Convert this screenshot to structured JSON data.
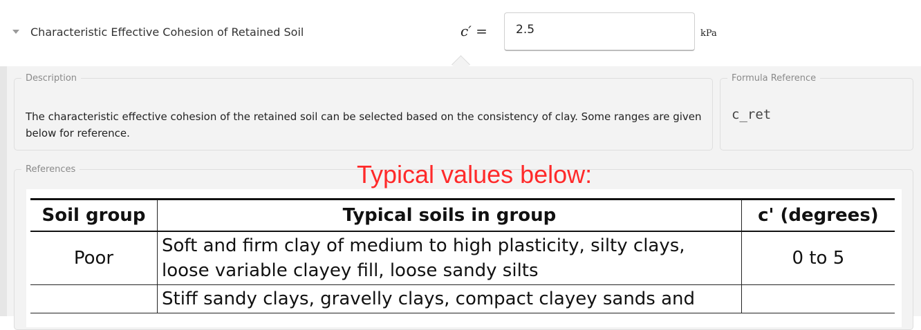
{
  "parameter": {
    "title": "Characteristic Effective Cohesion of Retained Soil",
    "symbol": "c′ =",
    "value": "2.5",
    "unit": "kPa"
  },
  "description": {
    "legend": "Description",
    "text": "The characteristic effective cohesion of the retained soil can be selected based on the consistency of clay. Some ranges are given below for reference."
  },
  "formula_reference": {
    "legend": "Formula Reference",
    "code": "c_ret"
  },
  "references": {
    "legend": "References",
    "heading": "Typical values below:",
    "table": {
      "headers": [
        "Soil group",
        "Typical soils in group",
        "c' (degrees)"
      ],
      "rows": [
        {
          "group": "Poor",
          "soils": "Soft and firm clay of medium to high plasticity, silty clays, loose variable clayey fill, loose sandy silts",
          "value": "0 to 5"
        },
        {
          "group": "",
          "soils": "Stiff sandy clays, gravelly clays, compact clayey sands and",
          "value": ""
        }
      ]
    }
  },
  "colors": {
    "heading_red": "#ff2a2a",
    "panel_bg": "#f3f3f3"
  },
  "icons": {
    "expand": "caret-down-icon"
  }
}
